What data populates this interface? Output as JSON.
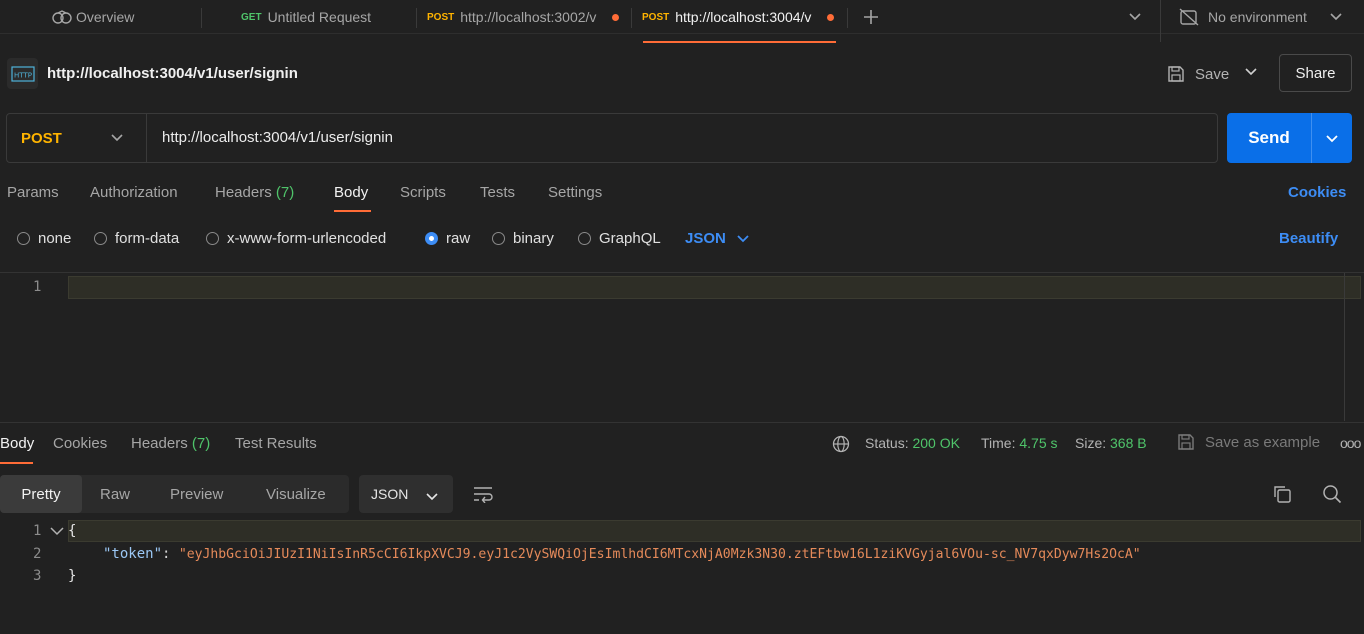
{
  "tabs": [
    {
      "method": "",
      "label": "Overview",
      "icon": "overview-icon"
    },
    {
      "method": "GET",
      "label": "Untitled Request",
      "method_color": "#4fc46a"
    },
    {
      "method": "POST",
      "label": "http://localhost:3002/v",
      "method_color": "#ffb400",
      "unsaved": true
    },
    {
      "method": "POST",
      "label": "http://localhost:3004/v",
      "method_color": "#ffb400",
      "unsaved": true,
      "active": true
    }
  ],
  "environment": {
    "label": "No environment"
  },
  "request": {
    "title": "http://localhost:3004/v1/user/signin",
    "save_label": "Save",
    "share_label": "Share",
    "method": "POST",
    "url": "http://localhost:3004/v1/user/signin",
    "send_label": "Send"
  },
  "request_tabs": {
    "params": "Params",
    "authorization": "Authorization",
    "headers": "Headers",
    "headers_count": "(7)",
    "body": "Body",
    "scripts": "Scripts",
    "tests": "Tests",
    "settings": "Settings",
    "cookies": "Cookies"
  },
  "body_types": {
    "none": "none",
    "form_data": "form-data",
    "urlencoded": "x-www-form-urlencoded",
    "raw": "raw",
    "binary": "binary",
    "graphql": "GraphQL",
    "selected": "raw",
    "format": "JSON",
    "beautify": "Beautify"
  },
  "request_editor": {
    "line_1": "1"
  },
  "response": {
    "tabs": {
      "body": "Body",
      "cookies": "Cookies",
      "headers": "Headers",
      "headers_count": "(7)",
      "test_results": "Test Results"
    },
    "status_label": "Status:",
    "status_value": "200 OK",
    "time_label": "Time:",
    "time_value": "4.75 s",
    "size_label": "Size:",
    "size_value": "368 B",
    "save_example": "Save as example",
    "more": "ooo",
    "views": {
      "pretty": "Pretty",
      "raw": "Raw",
      "preview": "Preview",
      "visualize": "Visualize"
    },
    "format": "JSON",
    "lines": {
      "n1": "1",
      "n2": "2",
      "n3": "3",
      "open_brace": "{",
      "key": "\"token\"",
      "colon": ": ",
      "value": "\"eyJhbGciOiJIUzI1NiIsInR5cCI6IkpXVCJ9.eyJ1c2VySWQiOjEsImlhdCI6MTcxNjA0Mzk3N30.ztEFtbw16L1ziKVGyjal6VOu-sc_NV7qxDyw7Hs2OcA\"",
      "close_brace": "}"
    }
  },
  "colors": {
    "accent": "#ff6c37",
    "send": "#0a6fe8",
    "link": "#3d8df5",
    "success": "#4fc46a",
    "post": "#ffb400"
  }
}
